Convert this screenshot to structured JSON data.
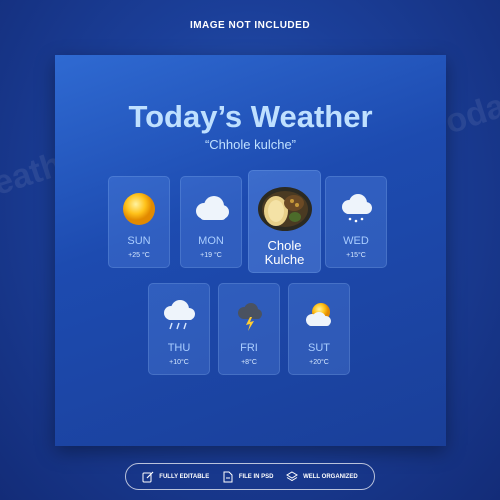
{
  "caption": "IMAGE NOT INCLUDED",
  "card": {
    "title": "Today’s Weather",
    "subtitle": "“Chhole kulche”"
  },
  "tiles": [
    {
      "day": "SUN",
      "temp": "+25 °C",
      "icon": "sun-icon"
    },
    {
      "day": "MON",
      "temp": "+19 °C",
      "icon": "cloud-icon"
    },
    {
      "day": "WED",
      "temp": "+15°C",
      "icon": "snow-cloud-icon"
    },
    {
      "day": "THU",
      "temp": "+10°C",
      "icon": "rain-cloud-icon"
    },
    {
      "day": "FRI",
      "temp": "+8°C",
      "icon": "storm-cloud-icon"
    },
    {
      "day": "SUT",
      "temp": "+20°C",
      "icon": "sun-cloud-icon"
    }
  ],
  "feature": {
    "name_line1": "Chole",
    "name_line2": "Kulche",
    "icon": "food-icon"
  },
  "badges": [
    {
      "label": "FULLY EDITABLE",
      "icon": "edit-icon"
    },
    {
      "label": "FILE IN PSD",
      "icon": "file-icon"
    },
    {
      "label": "WELL ORGANIZED",
      "icon": "layers-icon"
    }
  ],
  "colors": {
    "accent": "#bfe0ff",
    "background": "#1b3f99",
    "card": "#2f6ad2"
  }
}
